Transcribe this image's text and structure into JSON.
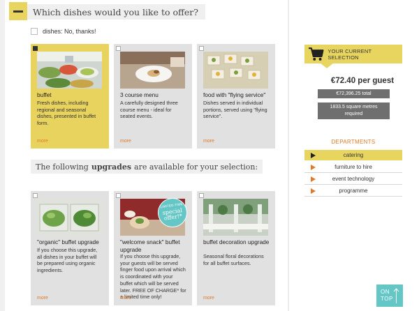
{
  "question": {
    "title": "Which dishes would you like to offer?"
  },
  "no_thanks": {
    "label": "dishes: No, thanks!"
  },
  "dishes": [
    {
      "title": "buffet",
      "desc": "Fresh dishes, including regional and seasonal dishes, presented in buffet form.",
      "more": "more",
      "selected": true
    },
    {
      "title": "3 course menu",
      "desc": "A carefully designed three course menu - ideal for seated events.",
      "more": "more",
      "selected": false
    },
    {
      "title": "food with \"flying service\"",
      "desc": "Dishes served in individual portions, served using \"flying service\".",
      "more": "more",
      "selected": false
    }
  ],
  "upgrades_header": {
    "pre": "The following",
    "bold": "upgrades",
    "post": "are available for your selection:"
  },
  "upgrades": [
    {
      "title": "\"organic\" buffet upgrade",
      "desc": "If you choose this upgrade, all dishes in your buffet will be prepared using organic ingredients.",
      "more": "more"
    },
    {
      "title": "\"welcome snack\" buffet upgrade",
      "desc": "If you choose this upgrade, your guests will be served finger food upon arrival which is coordinated with your buffet which will be served later. FREE OF CHARGE* for a limited time only!",
      "more": "more",
      "badge_line1": "LIMITED-TIME",
      "badge_line2": "special offer!*"
    },
    {
      "title": "buffet decoration upgrade",
      "desc": "Seasonal floral decorations for all buffet surfaces.",
      "more": "more"
    }
  ],
  "selection": {
    "label": "YOUR CURRENT SELECTION",
    "price_per_guest": "€72.40 per guest",
    "total": "€72,396.25 total",
    "area_line1": "1833.5 square metres",
    "area_line2": "required"
  },
  "departments": {
    "title": "DEPARTMENTS",
    "items": [
      "catering",
      "furniture to hire",
      "event technology",
      "programme"
    ],
    "active_index": 0
  },
  "on_top": {
    "line1": "ON",
    "line2": "TOP"
  },
  "colors": {
    "accent_yellow": "#e8d560",
    "orange": "#e07a2a",
    "teal": "#64c6c5",
    "card_gray": "#e1e1e1"
  }
}
